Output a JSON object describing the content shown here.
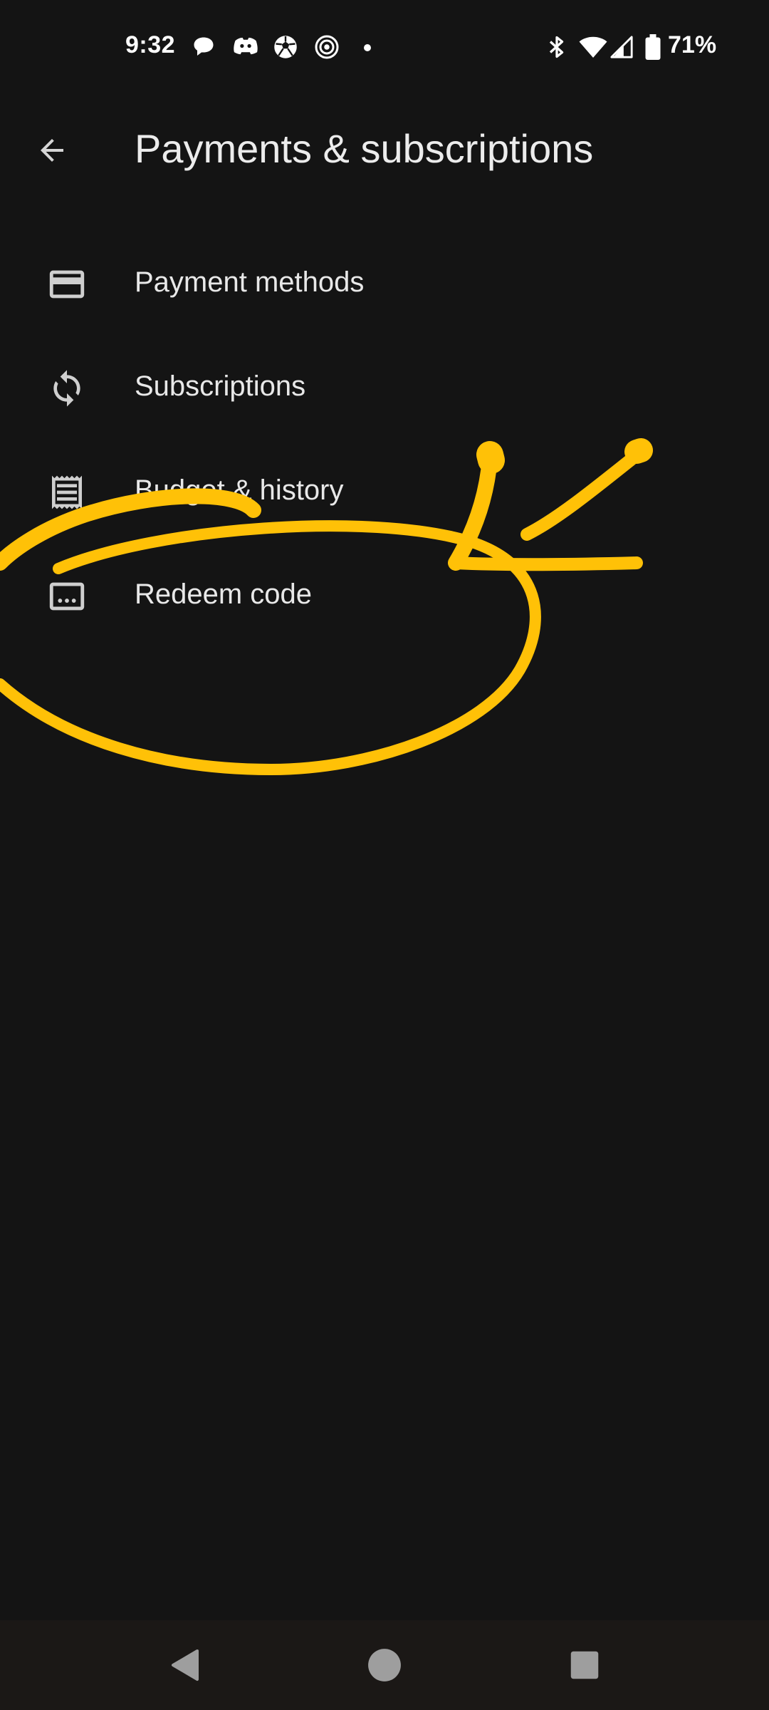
{
  "status_bar": {
    "time": "9:32",
    "battery_percent": "71%",
    "notification_icons": [
      "chat-bubble-icon",
      "discord-chat-icon",
      "soccer-ball-icon",
      "camera-lens-icon",
      "dot-icon"
    ],
    "system_icons": [
      "bluetooth-icon",
      "wifi-icon",
      "cell-signal-icon",
      "battery-icon"
    ]
  },
  "app_bar": {
    "title": "Payments & subscriptions",
    "back_icon": "arrow-back-icon"
  },
  "menu": {
    "items": [
      {
        "label": "Payment methods",
        "icon": "credit-card-icon"
      },
      {
        "label": "Subscriptions",
        "icon": "sync-icon"
      },
      {
        "label": "Budget & history",
        "icon": "receipt-icon"
      },
      {
        "label": "Redeem code",
        "icon": "redeem-code-icon"
      }
    ]
  },
  "annotation": {
    "color": "#FFC107",
    "highlighted_item": "Redeem code"
  },
  "nav_bar": {
    "buttons": [
      "back-triangle-icon",
      "home-circle-icon",
      "recents-square-icon"
    ],
    "icon_color": "#9e9e9e"
  },
  "colors": {
    "background": "#141414",
    "text_primary": "#e9e9e9",
    "icon": "#cfcfcf",
    "nav_background": "#1b1816"
  }
}
